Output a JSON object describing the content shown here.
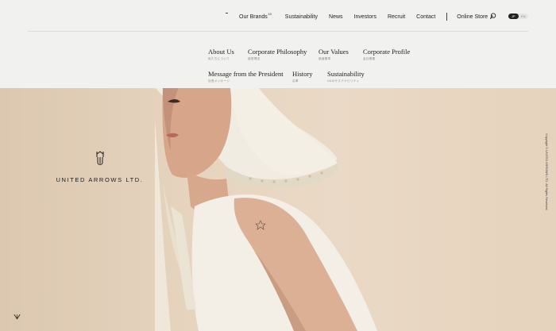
{
  "nav": {
    "items": [
      {
        "label": "Our Brands",
        "badge": "10"
      },
      {
        "label": "Sustainability"
      },
      {
        "label": "News"
      },
      {
        "label": "Investors"
      },
      {
        "label": "Recruit"
      },
      {
        "label": "Contact"
      }
    ],
    "online_store": "Online Store",
    "lang": {
      "jp": "JP",
      "en": "EN",
      "active": "JP"
    }
  },
  "menu": {
    "items": [
      {
        "en": "About Us",
        "jp": "私たちについて"
      },
      {
        "en": "Corporate Philosophy",
        "jp": "経営理念"
      },
      {
        "en": "Our Values",
        "jp": "価値基準"
      },
      {
        "en": "Corporate Profile",
        "jp": "会社概要"
      },
      {
        "en": "Message from the President",
        "jp": "社長メッセージ"
      },
      {
        "en": "History",
        "jp": "沿革"
      },
      {
        "en": "Sustainability",
        "jp": "UAのサステナビリティ"
      }
    ]
  },
  "brand": {
    "name": "UNITED ARROWS LTD."
  },
  "footer": {
    "copyright": "Copyright © UNITED ARROWS LTD. All Rights Reserved."
  },
  "colors": {
    "panel": "#f1f1f0",
    "text": "#222222",
    "hero": "#e6d4bf"
  },
  "icons": {
    "search": "search-icon",
    "external": "external-link-icon",
    "scroll": "scroll-down-icon"
  }
}
